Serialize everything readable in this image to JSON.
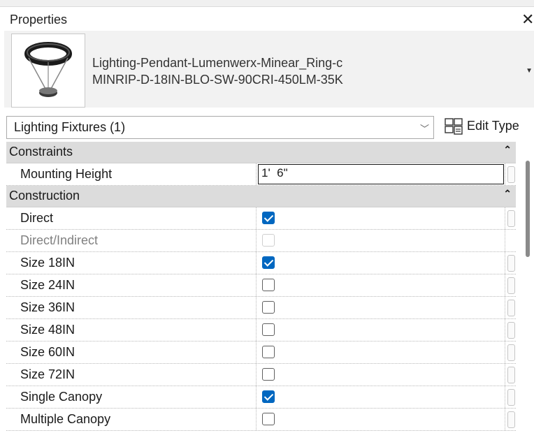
{
  "panel": {
    "title": "Properties",
    "close_glyph": "✕"
  },
  "type_selector": {
    "family": "Lighting-Pendant-Lumenwerx-Minear_Ring-c",
    "type": "MINRIP-D-18IN-BLO-SW-90CRI-450LM-35K",
    "thumbnail_icon": "pendant-ring-light-icon",
    "caret_glyph": "▼"
  },
  "instance_filter": {
    "value": "Lighting Fixtures (1)",
    "dropdown_glyph": "﹀"
  },
  "edit_type": {
    "label": "Edit Type",
    "icon": "edit-type-icon"
  },
  "groups": [
    {
      "label": "Constraints",
      "collapse_glyph": "⌃",
      "rows": [
        {
          "name": "Mounting Height",
          "kind": "text",
          "value": "1'  6\""
        }
      ]
    },
    {
      "label": "Construction",
      "collapse_glyph": "⌃",
      "rows": [
        {
          "name": "Direct",
          "kind": "checkbox",
          "checked": true,
          "disabled": false
        },
        {
          "name": "Direct/Indirect",
          "kind": "checkbox",
          "checked": false,
          "disabled": true
        },
        {
          "name": "Size 18IN",
          "kind": "checkbox",
          "checked": true,
          "disabled": false
        },
        {
          "name": "Size 24IN",
          "kind": "checkbox",
          "checked": false,
          "disabled": false
        },
        {
          "name": "Size 36IN",
          "kind": "checkbox",
          "checked": false,
          "disabled": false
        },
        {
          "name": "Size 48IN",
          "kind": "checkbox",
          "checked": false,
          "disabled": false
        },
        {
          "name": "Size 60IN",
          "kind": "checkbox",
          "checked": false,
          "disabled": false
        },
        {
          "name": "Size 72IN",
          "kind": "checkbox",
          "checked": false,
          "disabled": false
        },
        {
          "name": "Single Canopy",
          "kind": "checkbox",
          "checked": true,
          "disabled": false
        },
        {
          "name": "Multiple Canopy",
          "kind": "checkbox",
          "checked": false,
          "disabled": false
        }
      ]
    }
  ],
  "colors": {
    "checkbox_checked": "#0067c0",
    "group_header": "#dcdcdc"
  }
}
